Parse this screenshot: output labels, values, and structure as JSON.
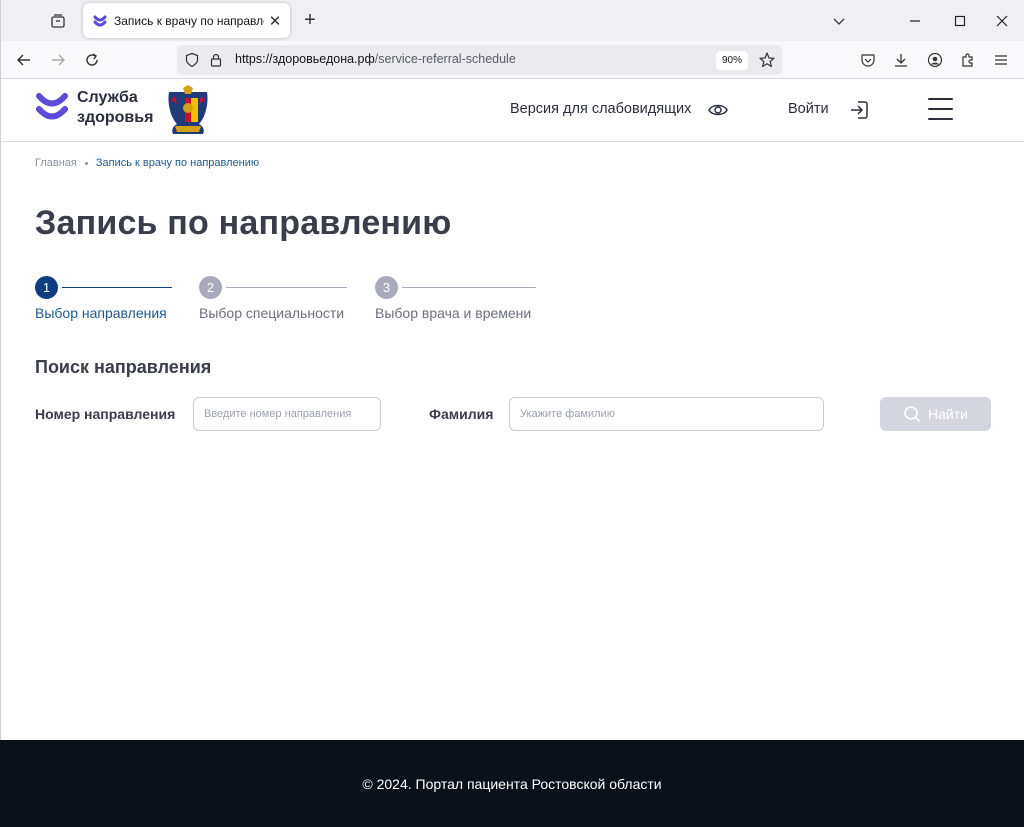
{
  "browser": {
    "tab_title": "Запись к врачу по направлению",
    "url_host": "https://здоровьедона.рф",
    "url_path": "/service-referral-schedule",
    "zoom": "90%"
  },
  "header": {
    "logo_line1": "Служба",
    "logo_line2": "здоровья",
    "low_vision_label": "Версия для слабовидящих",
    "login_label": "Войти"
  },
  "breadcrumb": {
    "home": "Главная",
    "current": "Запись к врачу по направлению"
  },
  "page": {
    "title": "Запись по направлению"
  },
  "steps": [
    {
      "number": "1",
      "label": "Выбор направления",
      "active": true
    },
    {
      "number": "2",
      "label": "Выбор специальности",
      "active": false
    },
    {
      "number": "3",
      "label": "Выбор врача и времени",
      "active": false
    }
  ],
  "search": {
    "section_title": "Поиск направления",
    "referral_label": "Номер направления",
    "referral_placeholder": "Введите номер направления",
    "referral_value": "",
    "surname_label": "Фамилия",
    "surname_placeholder": "Укажите фамилию",
    "surname_value": "",
    "button_label": "Найти"
  },
  "footer": {
    "copyright": "©  2024. Портал пациента Ростовской области"
  },
  "colors": {
    "accent": "#0f3d82",
    "step_inactive": "#a9abbd",
    "logo_purple": "#5b4bd6",
    "button_disabled": "#d3d6de",
    "footer_bg": "#0a111b"
  }
}
